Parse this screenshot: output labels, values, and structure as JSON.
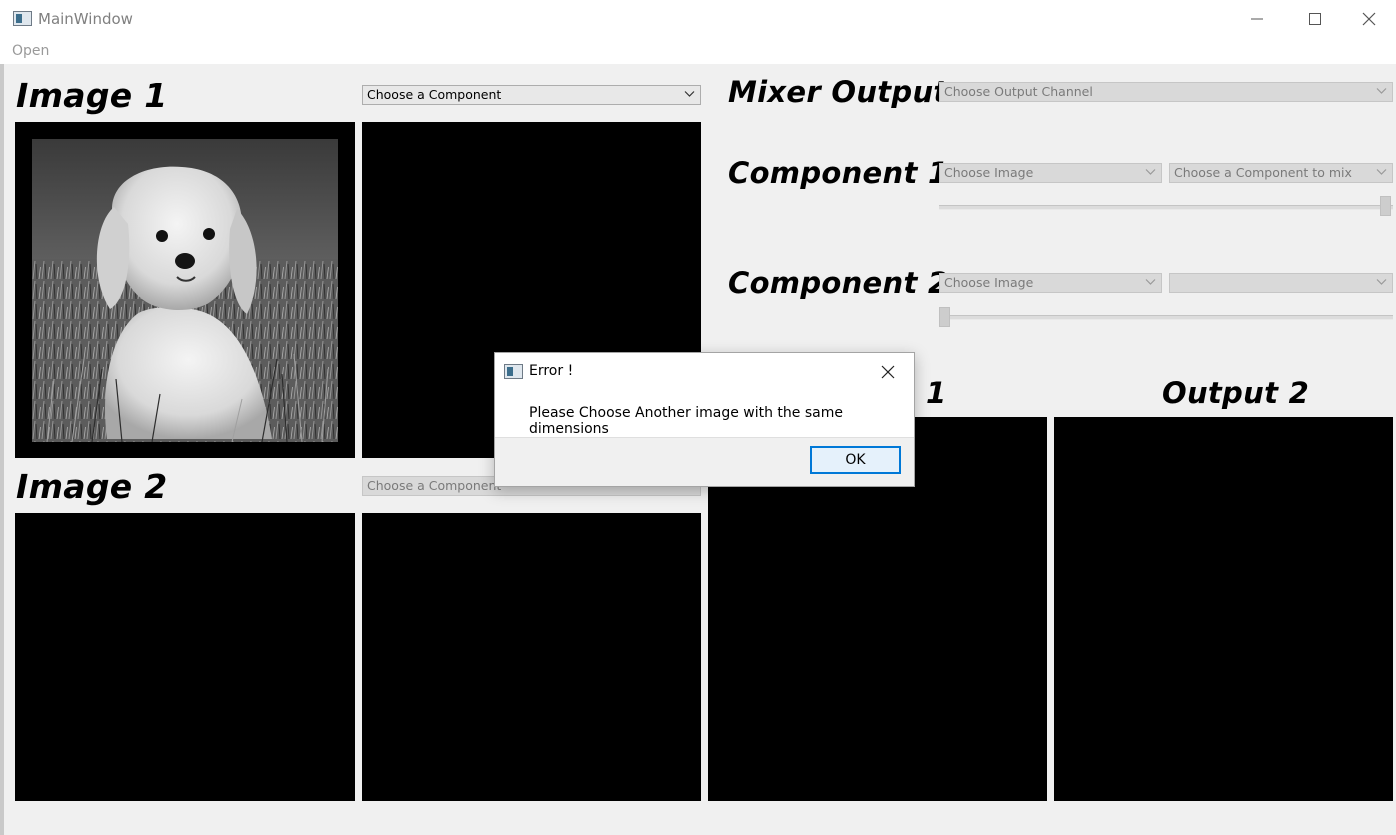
{
  "window": {
    "title": "MainWindow",
    "controls": [
      "minimize-icon",
      "maximize-icon",
      "close-icon"
    ]
  },
  "menu": {
    "open_label": "Open"
  },
  "image1": {
    "heading": "Image 1",
    "component_combo": "Choose a Component"
  },
  "image2": {
    "heading": "Image 2",
    "component_combo": "Choose a Component"
  },
  "mixer": {
    "heading": "Mixer Output",
    "output_channel_combo": "Choose Output Channel",
    "component1": {
      "heading": "Component 1",
      "image_combo": "Choose Image",
      "component_combo": "Choose a Component to mix",
      "slider_value_fraction": 1.0
    },
    "component2": {
      "heading": "Component 2",
      "image_combo": "Choose Image",
      "component_combo": "",
      "slider_value_fraction": 0.0
    }
  },
  "outputs": {
    "output1_heading_visible_part": "1",
    "output2_heading": "Output 2"
  },
  "dialog": {
    "title": "Error !",
    "message": "Please Choose Another image with the same dimensions",
    "ok_label": "OK"
  },
  "colors": {
    "panel": "#000000",
    "background": "#f0f0f0",
    "accent": "#0078d7"
  }
}
